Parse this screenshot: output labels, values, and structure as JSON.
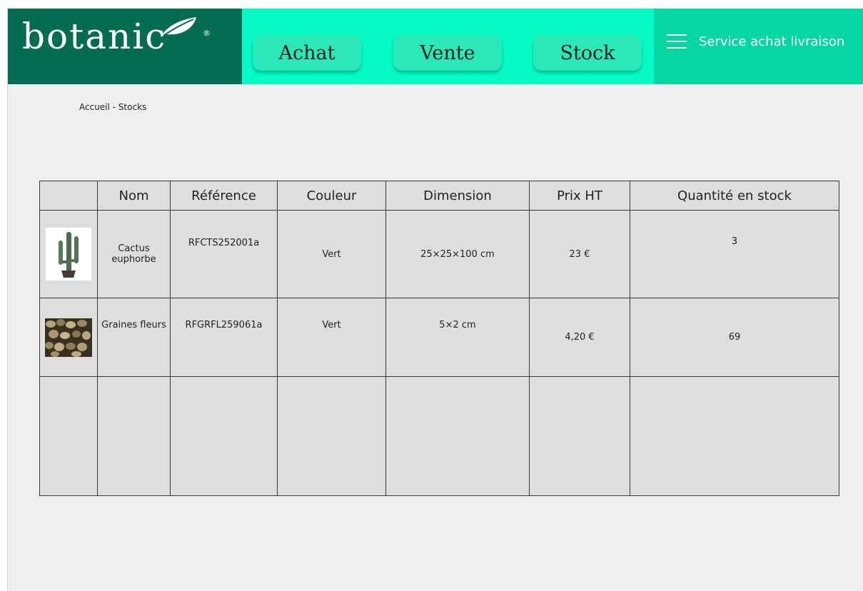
{
  "logo": {
    "text": "botanic",
    "trademark": "®",
    "bg_color": "#036d52"
  },
  "nav": {
    "bg_color": "#05fac4",
    "buttons": [
      {
        "label": "Achat"
      },
      {
        "label": "Vente"
      },
      {
        "label": "Stock"
      }
    ],
    "service": {
      "label": "Service achat livraison",
      "icon": "menu-icon"
    }
  },
  "breadcrumb": {
    "text": "Accueil  -  Stocks"
  },
  "table": {
    "headers": [
      "",
      "Nom",
      "Référence",
      "Couleur",
      "Dimension",
      "Prix HT",
      "Quantité en stock"
    ],
    "rows": [
      {
        "image": "cactus-image",
        "name": "Cactus euphorbe",
        "reference": "RFCTS252001a",
        "color": "Vert",
        "dimension": "25×25×100 cm",
        "price": "23 €",
        "quantity": "3"
      },
      {
        "image": "seeds-image",
        "name": "Graines fleurs",
        "reference": "RFGRFL259061a",
        "color": "Vert",
        "dimension": "5×2 cm",
        "price": "4,20 €",
        "quantity": "69"
      }
    ]
  }
}
